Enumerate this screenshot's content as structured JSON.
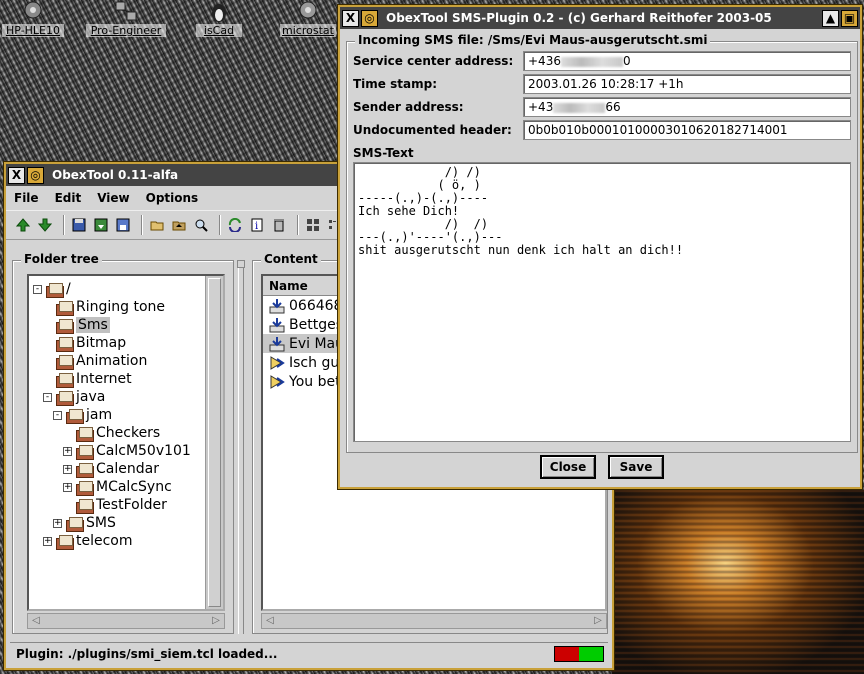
{
  "desktop": {
    "icons": [
      {
        "label": "HP-HLE10",
        "icon": "gear-icon"
      },
      {
        "label": "Pro-Engineer",
        "icon": "network-icon"
      },
      {
        "label": "isCad",
        "icon": "penguin-icon"
      },
      {
        "label": "microstat",
        "icon": "gear-icon"
      }
    ]
  },
  "main_window": {
    "title": "ObexTool 0.11-alfa",
    "menu": [
      {
        "label": "File"
      },
      {
        "label": "Edit"
      },
      {
        "label": "View"
      },
      {
        "label": "Options"
      }
    ],
    "toolbar_icons": [
      "arrow-up-icon",
      "arrow-down-icon",
      "floppy-icon",
      "floppy-arrow-icon",
      "floppy-box-icon",
      "folder-open-icon",
      "folder-up-icon",
      "magnifier-icon",
      "refresh-icon",
      "info-icon",
      "trash-icon",
      "view-large-icon",
      "view-small-icon",
      "view-list-icon",
      "view-detail-icon"
    ],
    "folder_tree": {
      "label": "Folder tree",
      "items": [
        {
          "label": "/",
          "depth": 0,
          "expander": "-"
        },
        {
          "label": "Ringing tone",
          "depth": 1,
          "expander": ""
        },
        {
          "label": "Sms",
          "depth": 1,
          "expander": "",
          "selected": true
        },
        {
          "label": "Bitmap",
          "depth": 1,
          "expander": ""
        },
        {
          "label": "Animation",
          "depth": 1,
          "expander": ""
        },
        {
          "label": "Internet",
          "depth": 1,
          "expander": ""
        },
        {
          "label": "java",
          "depth": 1,
          "expander": "-"
        },
        {
          "label": "jam",
          "depth": 2,
          "expander": "-"
        },
        {
          "label": "Checkers",
          "depth": 3,
          "expander": ""
        },
        {
          "label": "CalcM50v101",
          "depth": 3,
          "expander": "+"
        },
        {
          "label": "Calendar",
          "depth": 3,
          "expander": "+"
        },
        {
          "label": "MCalcSync",
          "depth": 3,
          "expander": "+"
        },
        {
          "label": "TestFolder",
          "depth": 3,
          "expander": ""
        },
        {
          "label": "SMS",
          "depth": 2,
          "expander": "+"
        },
        {
          "label": "telecom",
          "depth": 1,
          "expander": "+"
        }
      ]
    },
    "content": {
      "label": "Content",
      "column": "Name",
      "rows": [
        {
          "label": "066468",
          "icon": "sms-in-icon"
        },
        {
          "label": "Bettges",
          "icon": "sms-in-icon"
        },
        {
          "label": "Evi Mau",
          "icon": "sms-in-icon",
          "selected": true
        },
        {
          "label": "Isch gu",
          "icon": "sms-out-icon"
        },
        {
          "label": "You bet",
          "icon": "sms-out-icon"
        }
      ]
    },
    "status": "Plugin: ./plugins/smi_siem.tcl loaded...",
    "status_colors": {
      "left": "#cc0000",
      "right": "#00cc00"
    }
  },
  "sms_window": {
    "title": "ObexTool SMS-Plugin 0.2 - (c) Gerhard Reithofer 2003-05",
    "group_label": "Incoming SMS file: /Sms/Evi Maus-ausgerutscht.smi",
    "fields": [
      {
        "label": "Service center address:",
        "prefix": "+436",
        "suffix": "0"
      },
      {
        "label": "Time stamp:",
        "prefix": "2003.01.26 10:28:17 +1h",
        "suffix": ""
      },
      {
        "label": "Sender address:",
        "prefix": "+43",
        "suffix": "66"
      },
      {
        "label": "Undocumented header:",
        "prefix": "0b0b010b00010100003010620182714001",
        "suffix": ""
      }
    ],
    "sms_text_label": "SMS-Text",
    "sms_text": "            /) /)\n           ( ö, )\n-----(.,)-(.,)----\nIch sehe Dich!\n            /)  /)\n---(.,)'----'(.,)---\nshit ausgerutscht nun denk ich halt an dich!!",
    "buttons": {
      "close": "Close",
      "save": "Save"
    }
  },
  "colors": {
    "window_border": "#c9a13a",
    "titlebar": "#444444",
    "face": "#d4d4d4"
  }
}
